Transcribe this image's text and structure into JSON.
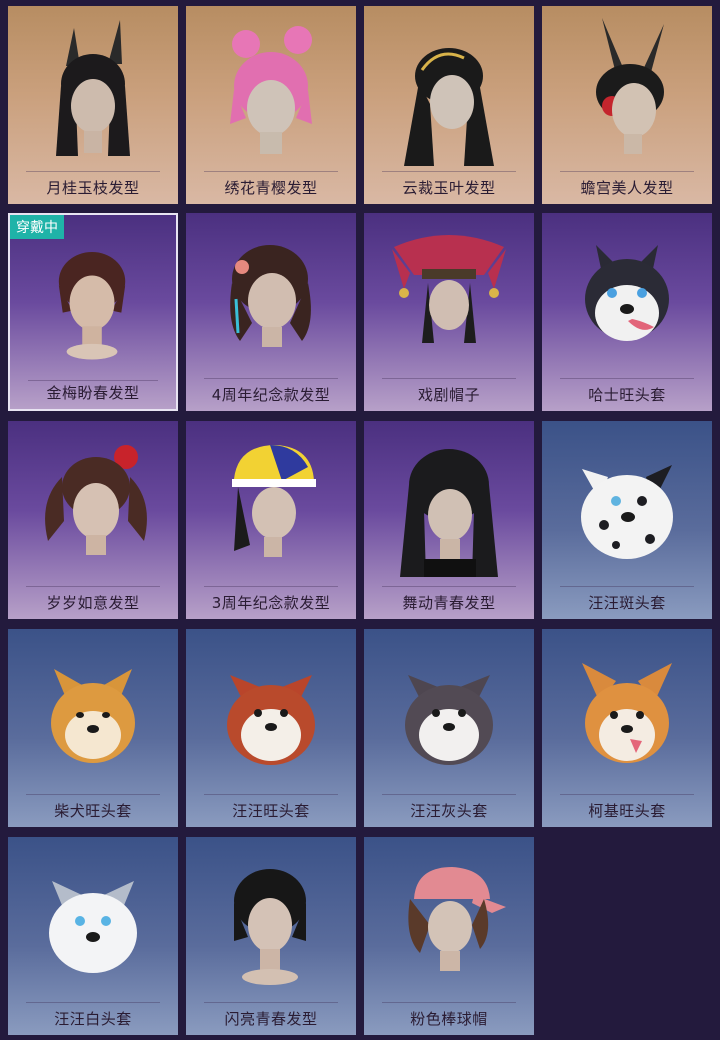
{
  "badge_text": "穿戴中",
  "items": [
    {
      "label": "月桂玉枝发型",
      "theme": "gold",
      "icon": "bunny-ears-hairstyle-icon"
    },
    {
      "label": "绣花青樱发型",
      "theme": "gold",
      "icon": "pink-bun-hairstyle-icon"
    },
    {
      "label": "云裁玉叶发型",
      "theme": "gold",
      "icon": "ornament-hairstyle-icon"
    },
    {
      "label": "蟾宫美人发型",
      "theme": "gold",
      "icon": "rabbit-headdress-hairstyle-icon"
    },
    {
      "label": "金梅盼春发型",
      "theme": "purple",
      "icon": "short-bob-hairstyle-icon",
      "equipped": true
    },
    {
      "label": "4周年纪念款发型",
      "theme": "purple",
      "icon": "wavy-hairstyle-icon"
    },
    {
      "label": "戏剧帽子",
      "theme": "purple",
      "icon": "jester-hat-icon"
    },
    {
      "label": "哈士旺头套",
      "theme": "purple",
      "icon": "husky-mask-icon"
    },
    {
      "label": "岁岁如意发型",
      "theme": "purple",
      "icon": "pigtail-hairstyle-icon"
    },
    {
      "label": "3周年纪念款发型",
      "theme": "purple",
      "icon": "cap-hairstyle-icon"
    },
    {
      "label": "舞动青春发型",
      "theme": "purple",
      "icon": "bangs-hairstyle-icon"
    },
    {
      "label": "汪汪斑头套",
      "theme": "blue",
      "icon": "dalmatian-mask-icon"
    },
    {
      "label": "柴犬旺头套",
      "theme": "blue",
      "icon": "shiba-mask-icon"
    },
    {
      "label": "汪汪旺头套",
      "theme": "blue",
      "icon": "red-dog-mask-icon"
    },
    {
      "label": "汪汪灰头套",
      "theme": "blue",
      "icon": "grey-dog-mask-icon"
    },
    {
      "label": "柯基旺头套",
      "theme": "blue",
      "icon": "corgi-mask-icon"
    },
    {
      "label": "汪汪白头套",
      "theme": "blue",
      "icon": "white-dog-mask-icon"
    },
    {
      "label": "闪亮青春发型",
      "theme": "blue",
      "icon": "short-black-hairstyle-icon"
    },
    {
      "label": "粉色棒球帽",
      "theme": "blue",
      "icon": "pink-cap-icon"
    }
  ],
  "colors": {
    "equipped_badge": "#1fb3a8",
    "page_bg": "#231a3d"
  }
}
